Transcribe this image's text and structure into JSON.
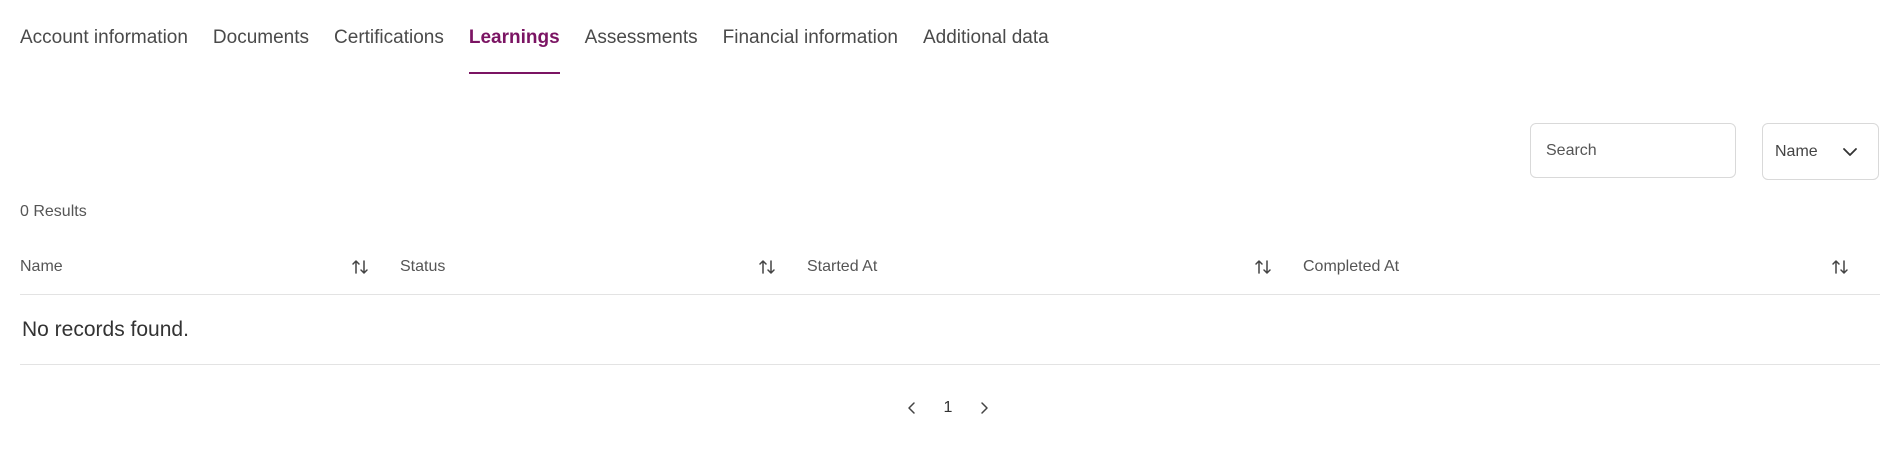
{
  "tabs": [
    {
      "label": "Account information",
      "active": false
    },
    {
      "label": "Documents",
      "active": false
    },
    {
      "label": "Certifications",
      "active": false
    },
    {
      "label": "Learnings",
      "active": true
    },
    {
      "label": "Assessments",
      "active": false
    },
    {
      "label": "Financial information",
      "active": false
    },
    {
      "label": "Additional data",
      "active": false
    }
  ],
  "search": {
    "placeholder": "Search",
    "value": ""
  },
  "sort_select": {
    "selected": "Name",
    "icon": "chevron-down-icon"
  },
  "results": {
    "text": "0 Results"
  },
  "table": {
    "columns": [
      {
        "label": "Name",
        "icon": "sort-icon"
      },
      {
        "label": "Status",
        "icon": "sort-icon"
      },
      {
        "label": "Started At",
        "icon": "sort-icon"
      },
      {
        "label": "Completed At",
        "icon": "sort-icon"
      }
    ],
    "empty_message": "No records found."
  },
  "pagination": {
    "current_page": "1",
    "prev_icon": "chevron-left-icon",
    "next_icon": "chevron-right-icon"
  },
  "colors": {
    "accent": "#7b1463",
    "border": "#d9d9d9",
    "divider": "#e3e3e3"
  }
}
